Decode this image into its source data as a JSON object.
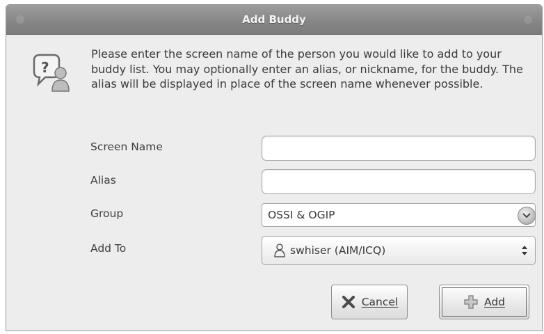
{
  "window": {
    "title": "Add Buddy"
  },
  "message": "Please enter the screen name of the person you would like to add to your buddy list. You may optionally enter an alias, or nickname, for the buddy. The alias will be displayed in place of the screen name whenever possible.",
  "form": {
    "screen_name": {
      "label": "Screen Name",
      "value": ""
    },
    "alias": {
      "label": "Alias",
      "value": ""
    },
    "group": {
      "label": "Group",
      "value": "OSSI & OGIP"
    },
    "add_to": {
      "label": "Add To",
      "value": "swhiser (AIM/ICQ)"
    }
  },
  "buttons": {
    "cancel": "Cancel",
    "add": "Add"
  },
  "icons": [
    "dialog-question-buddy-icon",
    "chevron-down-icon",
    "person-icon",
    "updown-arrows-icon",
    "cancel-x-icon",
    "add-plus-icon"
  ],
  "colors": {
    "titlebar": "#878787",
    "window_bg": "#ededed",
    "text": "#3a3a3a"
  }
}
